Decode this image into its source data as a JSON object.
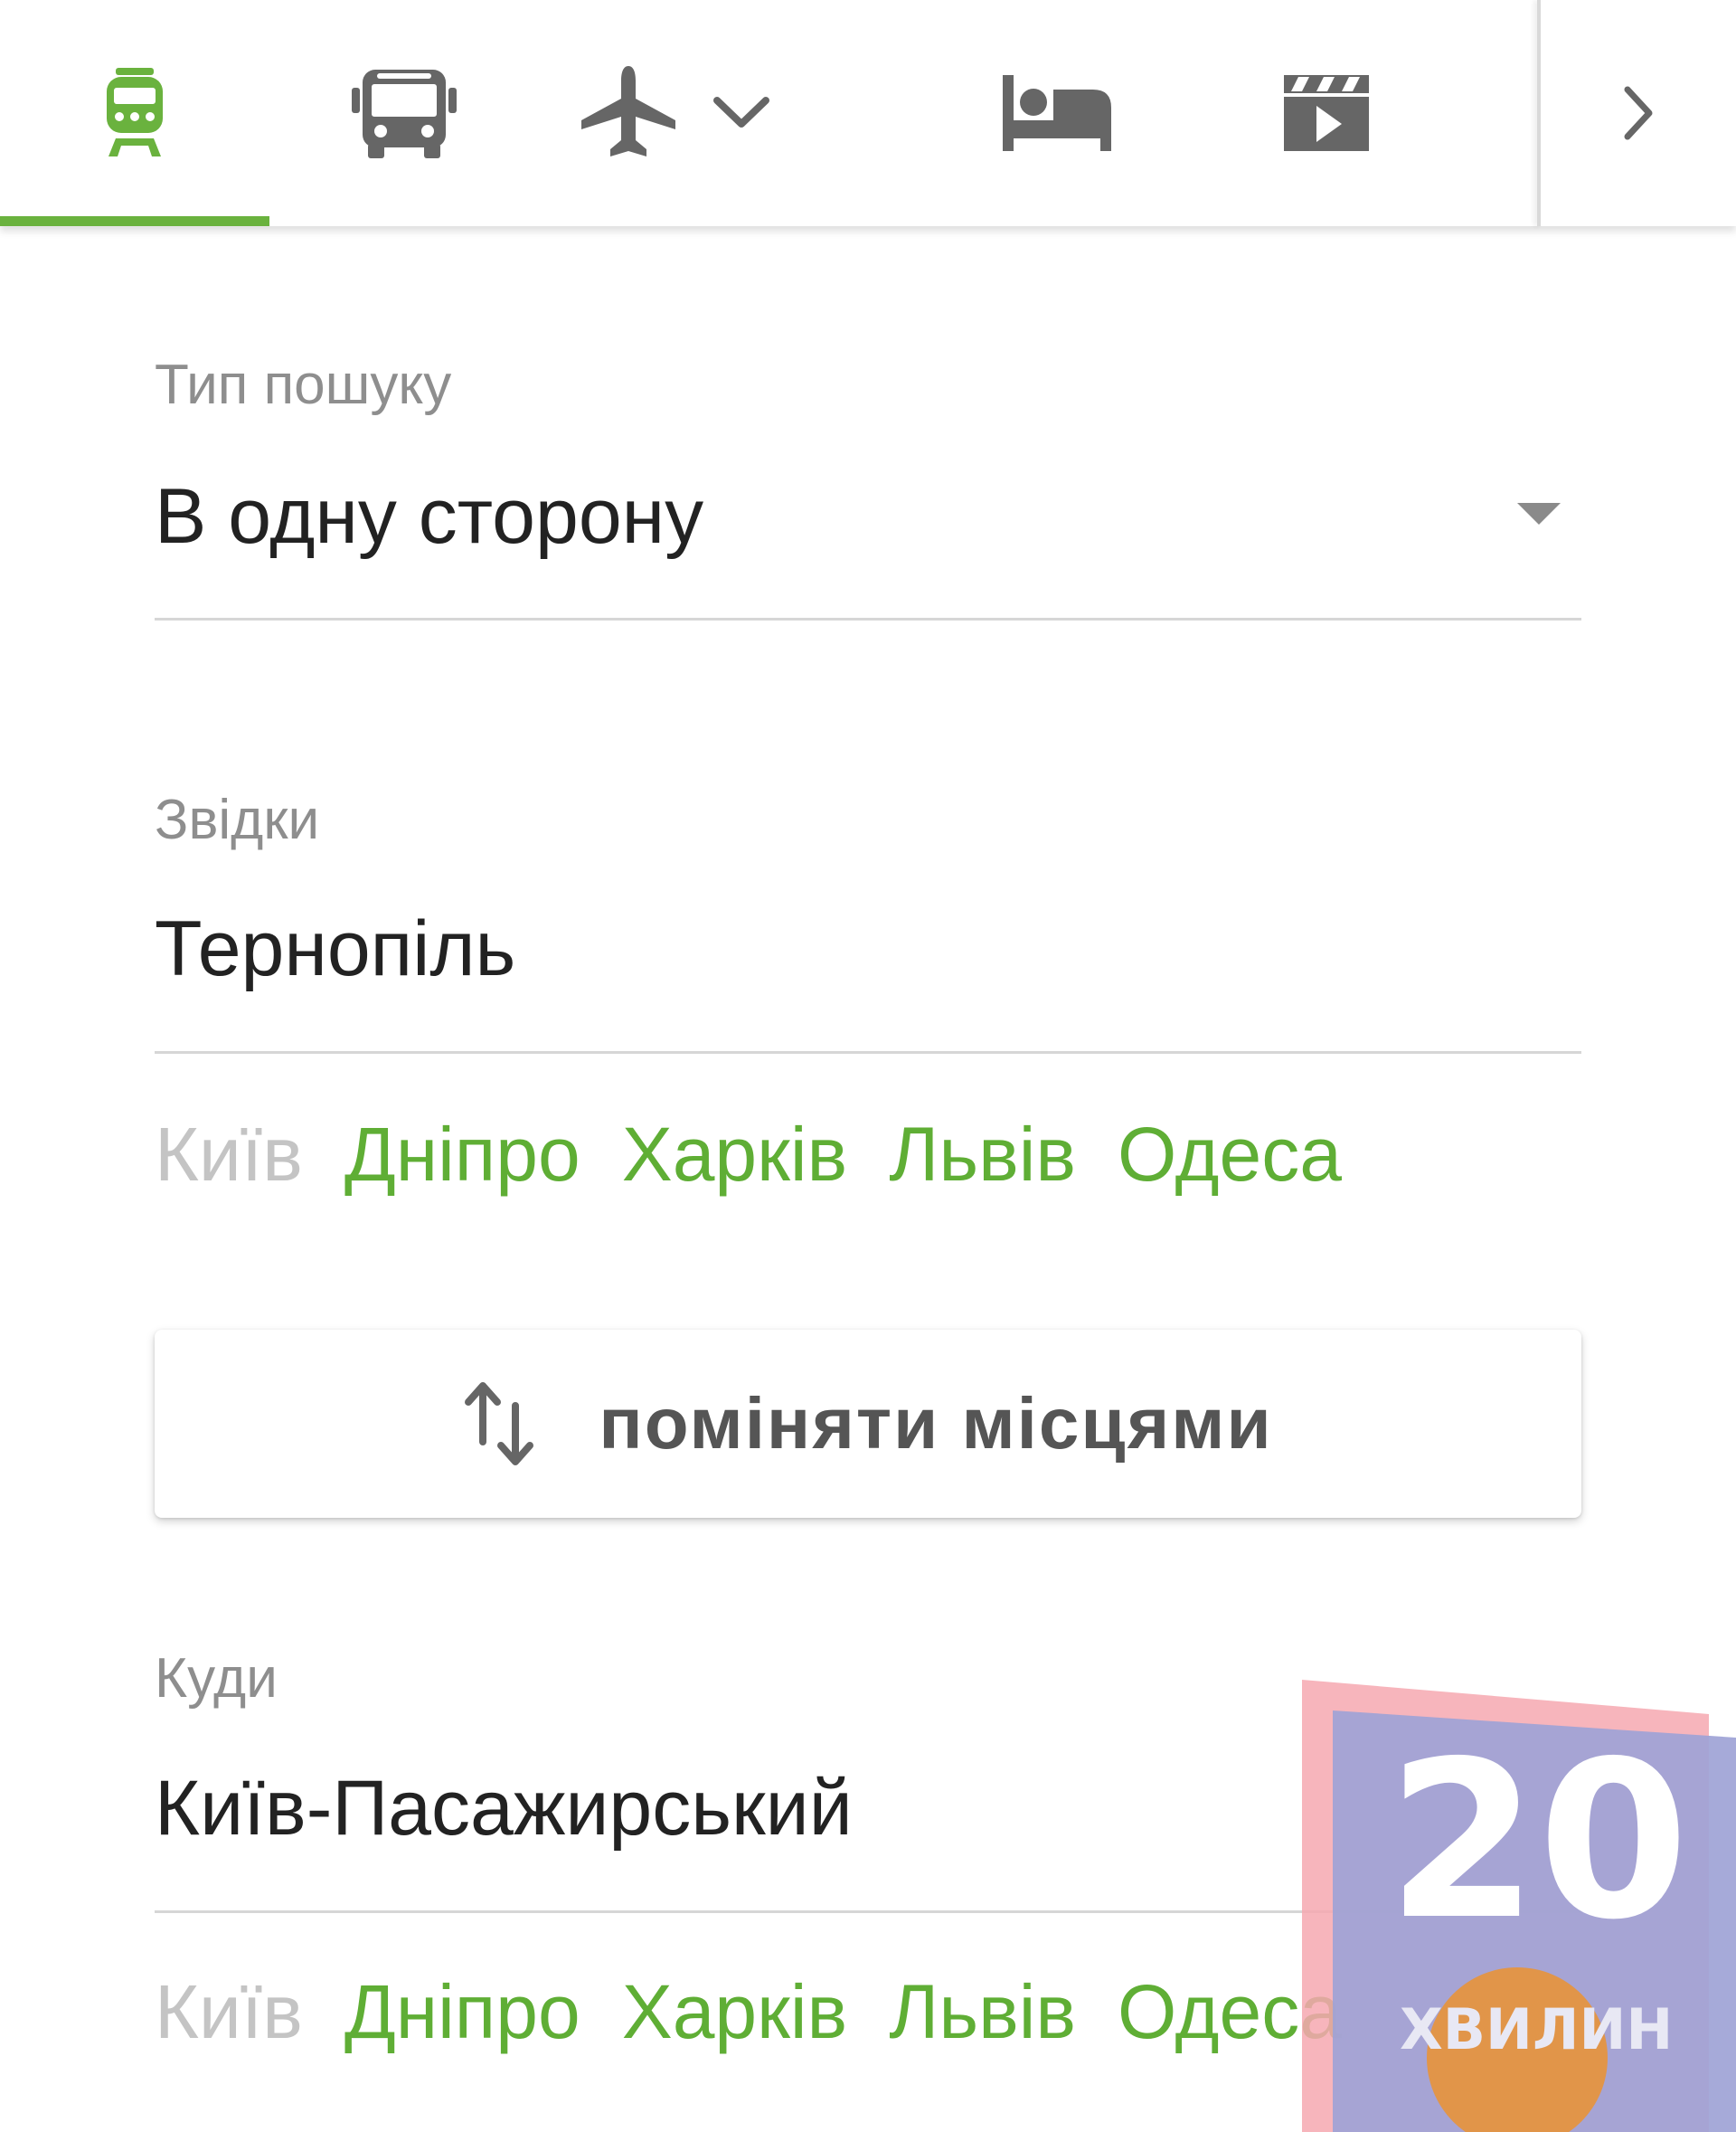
{
  "nav": {
    "tabs": [
      {
        "icon": "train-icon",
        "active": true
      },
      {
        "icon": "bus-icon",
        "active": false
      },
      {
        "icon": "plane-icon",
        "active": false,
        "has_dropdown": true
      },
      {
        "icon": "bed-icon",
        "active": false
      },
      {
        "icon": "movie-icon",
        "active": false
      }
    ],
    "more_icon": "chevron-right-icon"
  },
  "search_type": {
    "label": "Тип пошуку",
    "value": "В одну сторону"
  },
  "from": {
    "label": "Звідки",
    "value": "Тернопіль",
    "quick": [
      "Київ",
      "Дніпро",
      "Харків",
      "Львів",
      "Одеса"
    ]
  },
  "swap": {
    "label": "поміняти місцями",
    "icon": "swap-vertical-icon"
  },
  "to": {
    "label": "Куди",
    "value": "Київ-Пасажирський",
    "quick": [
      "Київ",
      "Дніпро",
      "Харків",
      "Львів",
      "Одеса"
    ]
  },
  "watermark": {
    "number": "20",
    "word": "ХВИЛИН"
  },
  "colors": {
    "accent": "#6ab23e",
    "link": "#5fae35",
    "icon_gray": "#666666",
    "disabled": "#c4c4c4"
  }
}
